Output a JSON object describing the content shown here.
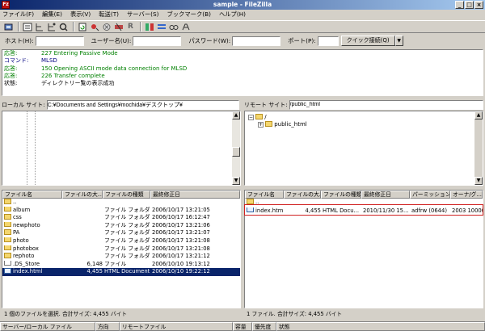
{
  "window": {
    "title": "sample - FileZilla",
    "app_icon": "filezilla-icon"
  },
  "menu": [
    "ファイル(F)",
    "編集(E)",
    "表示(V)",
    "転送(T)",
    "サーバー(S)",
    "ブックマーク(B)",
    "ヘルプ(H)"
  ],
  "toolbar": [
    "site-manager-icon",
    "log-icon",
    "local-tree-icon",
    "remote-tree-icon",
    "queue-icon",
    "refresh-icon",
    "process-queue-icon",
    "cancel-icon",
    "disconnect-icon",
    "reconnect-icon",
    "compare-icon",
    "sync-browse-icon",
    "search-icon",
    "binoculars-icon"
  ],
  "quickconnect": {
    "host_label": "ホスト(H):",
    "host_value": "",
    "user_label": "ユーザー名(U):",
    "user_value": "",
    "pass_label": "パスワード(W):",
    "pass_value": "",
    "port_label": "ポート(P):",
    "port_value": "",
    "button": "クイック接続(Q)",
    "dropdown": "▼"
  },
  "log": [
    {
      "label": "応答:",
      "text": "227 Entering Passive Mode",
      "color": "#008000"
    },
    {
      "label": "コマンド:",
      "text": "MLSD",
      "color": "#000080"
    },
    {
      "label": "応答:",
      "text": "150 Opening ASCII mode data connection for MLSD",
      "color": "#008000"
    },
    {
      "label": "応答:",
      "text": "226 Transfer complete",
      "color": "#008000"
    },
    {
      "label": "状態:",
      "text": "ディレクトリー覧の表示成功",
      "color": "#000000"
    }
  ],
  "local": {
    "site_label": "ローカル サイト:",
    "path": "C:¥Documents and Settings¥mochida¥デスクトップ¥",
    "columns": [
      "ファイル名",
      "ファイルの大...",
      "ファイルの種類",
      "最終修正日"
    ],
    "files": [
      {
        "name": "..",
        "size": "",
        "type": "",
        "date": "",
        "icon": "folder"
      },
      {
        "name": "album",
        "size": "",
        "type": "ファイル フォルダ",
        "date": "2006/10/17 13:21:05",
        "icon": "folder"
      },
      {
        "name": "css",
        "size": "",
        "type": "ファイル フォルダ",
        "date": "2006/10/17 16:12:47",
        "icon": "folder"
      },
      {
        "name": "newphoto",
        "size": "",
        "type": "ファイル フォルダ",
        "date": "2006/10/17 13:21:06",
        "icon": "folder"
      },
      {
        "name": "PA",
        "size": "",
        "type": "ファイル フォルダ",
        "date": "2006/10/17 13:21:07",
        "icon": "folder"
      },
      {
        "name": "photo",
        "size": "",
        "type": "ファイル フォルダ",
        "date": "2006/10/17 13:21:08",
        "icon": "folder"
      },
      {
        "name": "photobox",
        "size": "",
        "type": "ファイル フォルダ",
        "date": "2006/10/17 13:21:08",
        "icon": "folder"
      },
      {
        "name": "rephoto",
        "size": "",
        "type": "ファイル フォルダ",
        "date": "2006/10/17 13:21:12",
        "icon": "folder"
      },
      {
        "name": ".DS_Store",
        "size": "6,148",
        "type": "ファイル",
        "date": "2006/10/10 19:13:12",
        "icon": "file"
      },
      {
        "name": "index.html",
        "size": "4,455",
        "type": "HTML Document",
        "date": "2006/10/10 19:22:12",
        "icon": "html",
        "selected": true
      }
    ],
    "status": "1 個のファイルを選択. 合計サイズ: 4,455 バイト"
  },
  "remote": {
    "site_label": "リモート サイト:",
    "path": "/public_html",
    "tree": [
      {
        "name": "/",
        "level": 0
      },
      {
        "name": "public_html",
        "level": 1
      }
    ],
    "columns": [
      "ファイル名",
      "ファイルの大...",
      "ファイルの種類",
      "最終修正日",
      "パーミッション",
      "オーナ/グ..."
    ],
    "files": [
      {
        "name": "..",
        "size": "",
        "type": "",
        "date": "",
        "perm": "",
        "owner": "",
        "icon": "folder"
      },
      {
        "name": "index.html",
        "size": "4,455",
        "type": "HTML Docu...",
        "date": "2010/11/30 15...",
        "perm": "adfrw (0644)",
        "owner": "2003 10000",
        "icon": "html"
      }
    ],
    "status": "1 ファイル. 合計サイズ: 4,455 バイト"
  },
  "queue": {
    "columns": [
      "サーバー/ローカル ファイル",
      "方向",
      "リモートファイル",
      "容量",
      "優先度",
      "状態"
    ]
  },
  "highlight_color": "#d02020"
}
